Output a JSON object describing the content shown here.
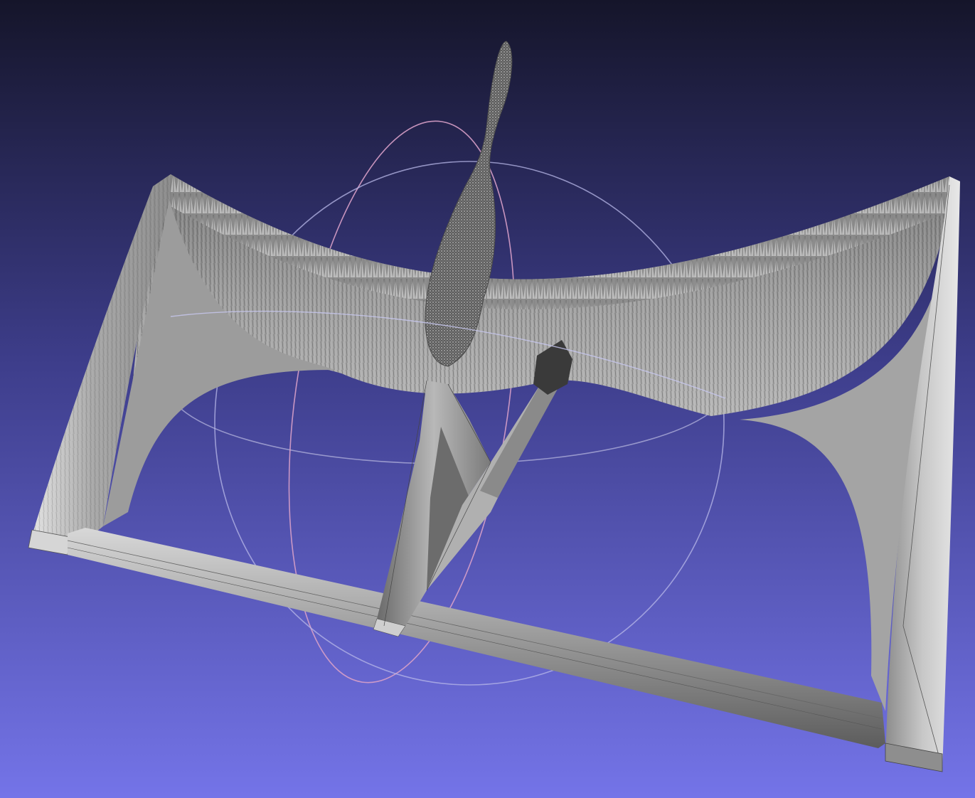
{
  "viewer": {
    "colors": {
      "background_top": "#15152a",
      "background_mid": "#3f3f8c",
      "background_bottom": "#7373e6",
      "mesh_light": "#d9d9d9",
      "mesh_mid": "#9e9e9e",
      "mesh_dark": "#5a5a5a",
      "wire": "#3a3a3a",
      "trackball_x": "#e0a0c8",
      "trackball_y": "#a8a8d8",
      "trackball_z": "#c0c0f0"
    },
    "icons": {
      "trackball": "trackball-gizmo-icon"
    }
  }
}
